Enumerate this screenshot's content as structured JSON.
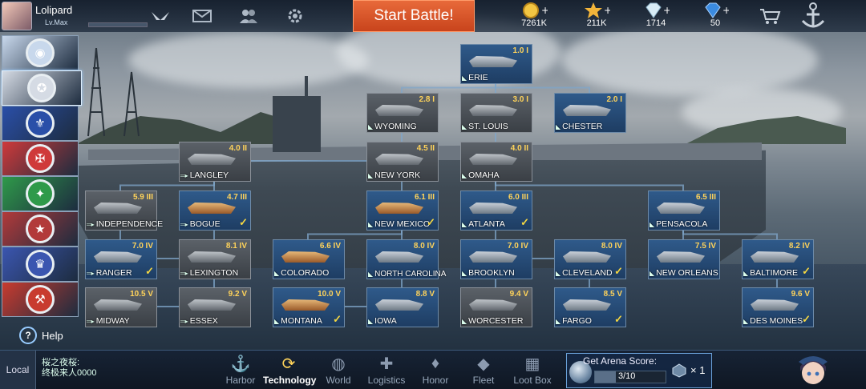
{
  "player": {
    "name": "Lolipard",
    "level": "Lv.Max"
  },
  "top_icons": [
    "mail-icon",
    "friends-icon",
    "settings-icon"
  ],
  "start_battle": "Start Battle!",
  "resources": [
    {
      "name": "coin-icon",
      "value": "7261K"
    },
    {
      "name": "star-icon",
      "value": "211K"
    },
    {
      "name": "diamond-icon",
      "value": "1714"
    },
    {
      "name": "gem-icon",
      "value": "50"
    }
  ],
  "nations": [
    {
      "name": "nation-1",
      "color": "#c8d8ec",
      "active": false
    },
    {
      "name": "nation-usa",
      "color": "#d5dbe4",
      "active": true
    },
    {
      "name": "nation-france",
      "color": "#2a4fa8",
      "active": false
    },
    {
      "name": "nation-germany",
      "color": "#cf3a3a",
      "active": false
    },
    {
      "name": "nation-italy",
      "color": "#2f9a4a",
      "active": false
    },
    {
      "name": "nation-japan",
      "color": "#b23a3a",
      "active": false
    },
    {
      "name": "nation-uk",
      "color": "#3b56b0",
      "active": false
    },
    {
      "name": "nation-ussr",
      "color": "#c83b2f",
      "active": false
    }
  ],
  "help_label": "Help",
  "ships": [
    {
      "name": "ERIE",
      "tier": "1.0",
      "rank": "I",
      "type": "cruiser",
      "locked": false,
      "researched": false
    },
    {
      "name": "WYOMING",
      "tier": "2.8",
      "rank": "I",
      "type": "cruiser",
      "locked": true,
      "researched": false
    },
    {
      "name": "ST. LOUIS",
      "tier": "3.0",
      "rank": "I",
      "type": "cruiser",
      "locked": true,
      "researched": false
    },
    {
      "name": "CHESTER",
      "tier": "2.0",
      "rank": "I",
      "type": "cruiser",
      "locked": false,
      "researched": false
    },
    {
      "name": "LANGLEY",
      "tier": "4.0",
      "rank": "II",
      "type": "carrier",
      "locked": true,
      "researched": false
    },
    {
      "name": "NEW YORK",
      "tier": "4.5",
      "rank": "II",
      "type": "cruiser",
      "locked": true,
      "researched": false
    },
    {
      "name": "OMAHA",
      "tier": "4.0",
      "rank": "II",
      "type": "cruiser",
      "locked": true,
      "researched": false
    },
    {
      "name": "INDEPENDENCE",
      "tier": "5.9",
      "rank": "III",
      "type": "carrier",
      "locked": true,
      "researched": false
    },
    {
      "name": "BOGUE",
      "tier": "4.7",
      "rank": "III",
      "type": "carrier",
      "locked": false,
      "researched": true
    },
    {
      "name": "NEW MEXICO",
      "tier": "6.1",
      "rank": "III",
      "type": "cruiser",
      "locked": false,
      "researched": true
    },
    {
      "name": "ATLANTA",
      "tier": "6.0",
      "rank": "III",
      "type": "cruiser",
      "locked": false,
      "researched": true
    },
    {
      "name": "PENSACOLA",
      "tier": "6.5",
      "rank": "III",
      "type": "cruiser",
      "locked": false,
      "researched": false
    },
    {
      "name": "RANGER",
      "tier": "7.0",
      "rank": "IV",
      "type": "carrier",
      "locked": false,
      "researched": true
    },
    {
      "name": "LEXINGTON",
      "tier": "8.1",
      "rank": "IV",
      "type": "carrier",
      "locked": true,
      "researched": false
    },
    {
      "name": "COLORADO",
      "tier": "6.6",
      "rank": "IV",
      "type": "cruiser",
      "locked": false,
      "researched": false
    },
    {
      "name": "NORTH CAROLINA",
      "tier": "8.0",
      "rank": "IV",
      "type": "cruiser",
      "locked": false,
      "researched": false
    },
    {
      "name": "BROOKLYN",
      "tier": "7.0",
      "rank": "IV",
      "type": "cruiser",
      "locked": false,
      "researched": false
    },
    {
      "name": "CLEVELAND",
      "tier": "8.0",
      "rank": "IV",
      "type": "cruiser",
      "locked": false,
      "researched": true
    },
    {
      "name": "NEW ORLEANS",
      "tier": "7.5",
      "rank": "IV",
      "type": "cruiser",
      "locked": false,
      "researched": false
    },
    {
      "name": "BALTIMORE",
      "tier": "8.2",
      "rank": "IV",
      "type": "cruiser",
      "locked": false,
      "researched": true
    },
    {
      "name": "MIDWAY",
      "tier": "10.5",
      "rank": "V",
      "type": "carrier",
      "locked": true,
      "researched": false
    },
    {
      "name": "ESSEX",
      "tier": "9.2",
      "rank": "V",
      "type": "carrier",
      "locked": true,
      "researched": false
    },
    {
      "name": "MONTANA",
      "tier": "10.0",
      "rank": "V",
      "type": "cruiser",
      "locked": false,
      "researched": true
    },
    {
      "name": "IOWA",
      "tier": "8.8",
      "rank": "V",
      "type": "cruiser",
      "locked": false,
      "researched": false
    },
    {
      "name": "WORCESTER",
      "tier": "9.4",
      "rank": "V",
      "type": "cruiser",
      "locked": true,
      "researched": false
    },
    {
      "name": "FARGO",
      "tier": "8.5",
      "rank": "V",
      "type": "cruiser",
      "locked": false,
      "researched": true
    },
    {
      "name": "DES MOINES",
      "tier": "9.6",
      "rank": "V",
      "type": "cruiser",
      "locked": false,
      "researched": true
    }
  ],
  "chat": {
    "channel": "Local",
    "line1": "桜之夜桜:",
    "line2": "终极来人0000"
  },
  "tabs": [
    {
      "label": "Harbor",
      "icon": "harbor-icon",
      "active": false
    },
    {
      "label": "Technology",
      "icon": "technology-icon",
      "active": true
    },
    {
      "label": "World",
      "icon": "world-icon",
      "active": false
    },
    {
      "label": "Logistics",
      "icon": "logistics-icon",
      "active": false
    },
    {
      "label": "Honor",
      "icon": "honor-icon",
      "active": false
    },
    {
      "label": "Fleet",
      "icon": "fleet-icon",
      "active": false
    },
    {
      "label": "Loot Box",
      "icon": "loot-box-icon",
      "active": false
    }
  ],
  "arena": {
    "title": "Get Arena Score:",
    "progress": "3/10",
    "progress_fraction": 0.3,
    "multiplier": "× 1"
  }
}
